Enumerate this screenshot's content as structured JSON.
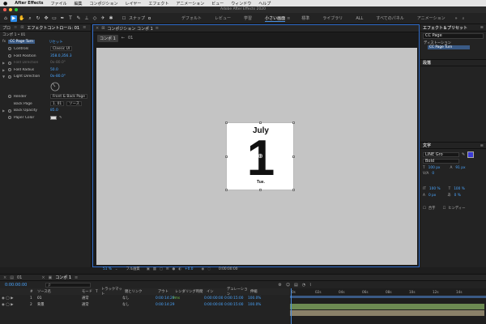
{
  "menubar": {
    "app": "After Effects",
    "items": [
      "ファイル",
      "編集",
      "コンポジション",
      "レイヤー",
      "エフェクト",
      "アニメーション",
      "ビュー",
      "ウィンドウ",
      "ヘルプ"
    ]
  },
  "window": {
    "title": "Adobe After Effects 2020"
  },
  "toolbar": {
    "snap_label": "スナップ",
    "workspaces": [
      "デフォルト",
      "レビュー",
      "学習",
      "小さい画面",
      "標準",
      "ライブラリ",
      "ALL",
      "すべてのパネル",
      "アニメーション"
    ],
    "selected_workspace": "小さい画面"
  },
  "left_panel": {
    "tab_project": "プロ",
    "tab_effect_controls": "エフェクトコントロール: 01",
    "breadcrumb": "コンポ 1 • 01",
    "effect_name": "CC Page Turn",
    "reset": "リセット",
    "props": {
      "controls": {
        "name": "Controls",
        "value": "Classic UI"
      },
      "fold_position": {
        "name": "Fold Position",
        "value": "358.0,356.3"
      },
      "fold_direction": {
        "name": "Fold Direction",
        "value": "0x-80.0°"
      },
      "fold_radius": {
        "name": "Fold Radius",
        "value": "50.0"
      },
      "light_direction": {
        "name": "Light Direction",
        "value": "0x-80.0°"
      },
      "render": {
        "name": "Render",
        "value": "Front & Back Page"
      },
      "back_page": {
        "name": "Back Page",
        "value": "1. 01",
        "src": "ソース"
      },
      "back_opacity": {
        "name": "Back Opacity",
        "value": "85.0"
      },
      "paper_color": {
        "name": "Paper Color"
      }
    }
  },
  "comp": {
    "tab_label": "コンポジション コンポ 1",
    "chip": "コンポ 1",
    "chip2": "01",
    "card": {
      "month": "July",
      "day": "1",
      "weekday": "Tue."
    },
    "bottom": {
      "zoom": "51 %",
      "quality": "フル画質",
      "exposure": "+0.0",
      "timecode": "0:00:00:00"
    }
  },
  "right_panel": {
    "effects_title": "エフェクト＆プリセット",
    "search_value": "CC Page",
    "category": "ディストーション",
    "effect_item": "CC Page Turn",
    "paragraph_title": "段落",
    "text_title": "文字",
    "font": "LINE Gro",
    "font_weight": "Bold",
    "font_size": "100 px",
    "leading": "91 px",
    "tracking": "0",
    "vscale": "100 %",
    "hscale": "100 %",
    "baseline": "0 px",
    "tsume": "0 %",
    "ligature": "合字",
    "hindi": "ヒンディー"
  },
  "timeline": {
    "tab1": "01",
    "tab2": "コンポ 1",
    "timecode": "0:00:00:00",
    "search_placeholder": "ρ",
    "columns": [
      "#",
      "ソース名",
      "モード",
      "T",
      "トラックマット",
      "親とリンク",
      "アウト",
      "レンダリング時間",
      "イン",
      "デュレーション",
      "伸縮"
    ],
    "layers": [
      {
        "num": "1",
        "name": "01",
        "mode": "通常",
        "parent": "なし",
        "out": "0:00:14:29",
        "render": "0ms",
        "in": "0:00:00:00",
        "dur": "0:00:15:00",
        "stretch": "100.0%"
      },
      {
        "num": "2",
        "name": "背景",
        "mode": "通常",
        "parent": "なし",
        "out": "0:00:14:29",
        "render": "",
        "in": "0:00:00:00",
        "dur": "0:00:15:00",
        "stretch": "100.0%"
      }
    ],
    "ruler": [
      "0s",
      "02s",
      "04s",
      "06s",
      "08s",
      "10s",
      "12s",
      "14s"
    ]
  },
  "colors": {
    "accent": "#2d8ceb",
    "link": "#4aa6ff",
    "selection_border": "#2f6bc9",
    "track_green": "#6c8a52",
    "track_tan": "#8a8169"
  }
}
